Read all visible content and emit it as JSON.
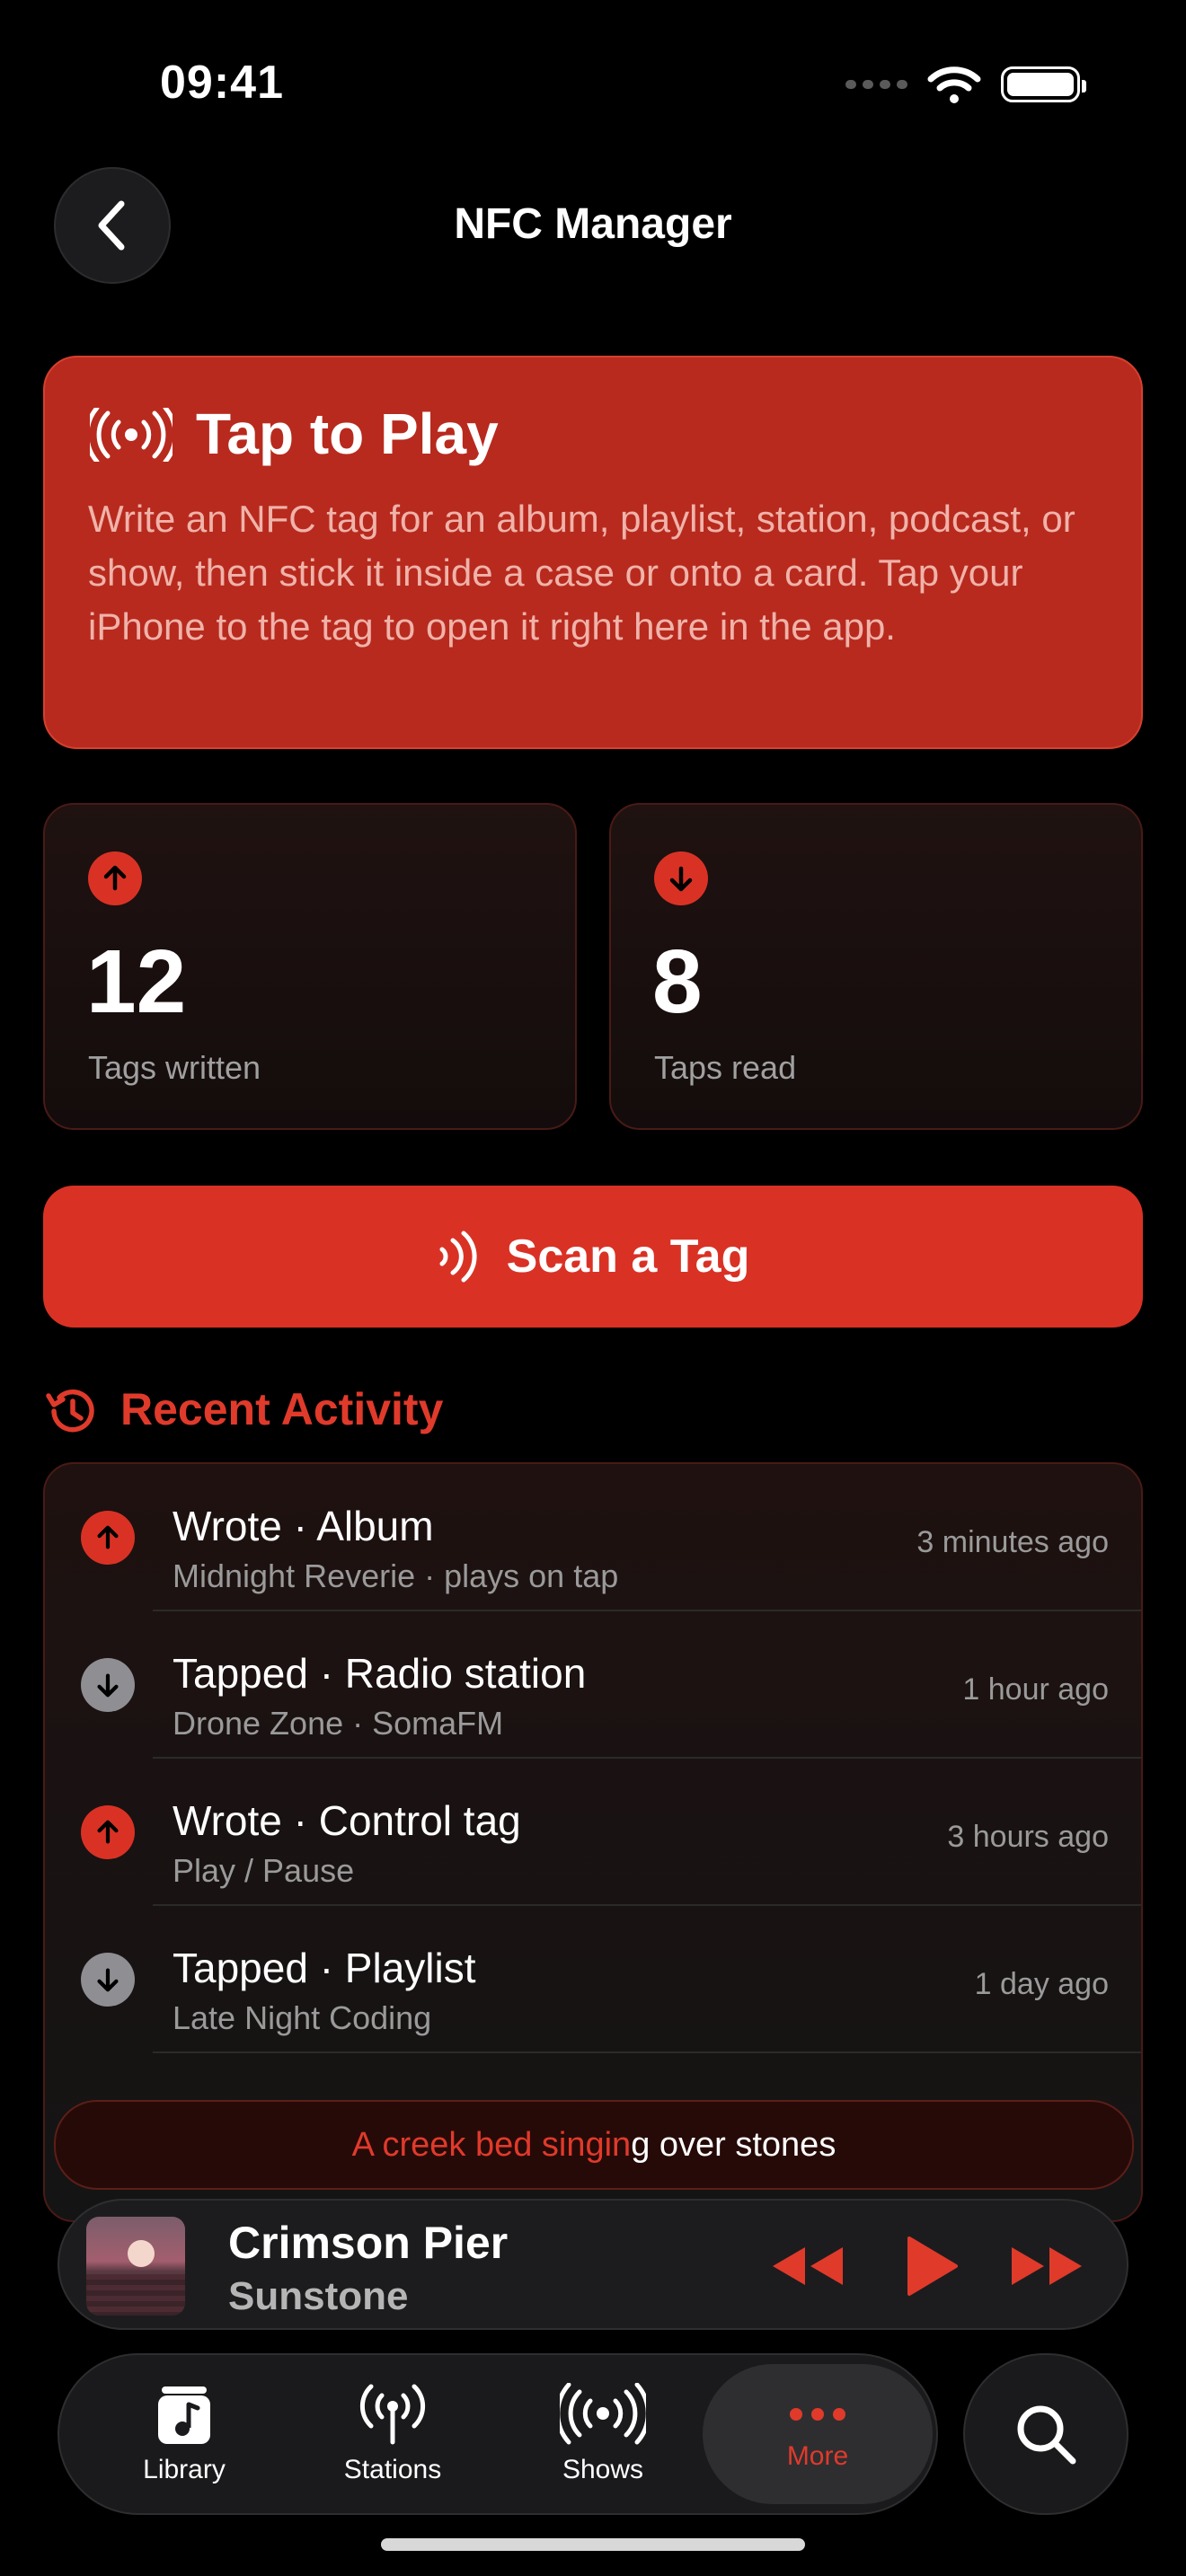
{
  "status_bar": {
    "time": "09:41"
  },
  "nav": {
    "title": "NFC Manager"
  },
  "hero": {
    "title": "Tap to Play",
    "body": "Write an NFC tag for an album, playlist, station, podcast, or show, then stick it inside a case or onto a card. Tap your iPhone to the tag to open it right here in the app."
  },
  "stats": [
    {
      "value": "12",
      "label": "Tags written",
      "icon": "arrow-up-icon"
    },
    {
      "value": "8",
      "label": "Taps read",
      "icon": "arrow-down-icon"
    }
  ],
  "scan_button": {
    "label": "Scan a Tag"
  },
  "recent": {
    "title": "Recent Activity",
    "items": [
      {
        "kind": "up",
        "title": "Wrote · Album",
        "subtitle": "Midnight Reverie · plays on tap",
        "time": "3 minutes ago"
      },
      {
        "kind": "down",
        "title": "Tapped · Radio station",
        "subtitle": "Drone Zone · SomaFM",
        "time": "1 hour ago"
      },
      {
        "kind": "up",
        "title": "Wrote · Control tag",
        "subtitle": "Play / Pause",
        "time": "3 hours ago"
      },
      {
        "kind": "down",
        "title": "Tapped · Playlist",
        "subtitle": "Late Night Coding",
        "time": "1 day ago"
      }
    ]
  },
  "lyric": {
    "highlighted": "A creek bed singin",
    "rest": "g over stones"
  },
  "now_playing": {
    "title": "Crimson Pier",
    "artist": "Sunstone"
  },
  "tabs": [
    {
      "label": "Library",
      "icon": "music-note-icon"
    },
    {
      "label": "Stations",
      "icon": "antenna-icon"
    },
    {
      "label": "Shows",
      "icon": "broadcast-icon"
    },
    {
      "label": "More",
      "icon": "more-dots-icon",
      "active": true
    }
  ],
  "colors": {
    "accent": "#d93225",
    "hero_bg": "#b82a1e",
    "background": "#000000"
  }
}
